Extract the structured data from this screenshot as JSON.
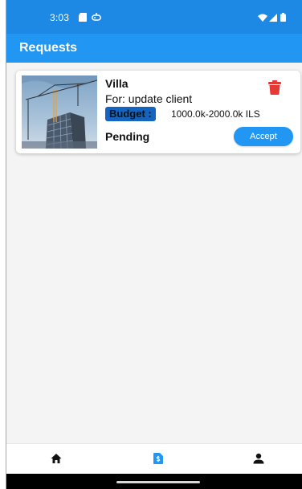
{
  "status_bar": {
    "time": "3:03",
    "icons": [
      "sd-card-icon",
      "game-controller-icon",
      "wifi-icon",
      "cell-signal-icon",
      "battery-icon"
    ]
  },
  "app_bar": {
    "title": "Requests"
  },
  "requests": [
    {
      "title": "Villa",
      "for_text": "For: update client",
      "budget_label": "Budget :",
      "budget_value": "1000.0k-2000.0k ILS",
      "status": "Pending",
      "accept_label": "Accept",
      "image": "construction-crane-building-photo"
    }
  ],
  "bottom_nav": {
    "items": [
      {
        "icon": "home-icon",
        "active": false
      },
      {
        "icon": "request-document-icon",
        "active": true
      },
      {
        "icon": "person-icon",
        "active": false
      }
    ]
  },
  "colors": {
    "primary": "#2196f3",
    "status_bar": "#1e88e5",
    "badge": "#1565c0",
    "delete": "#e53935",
    "nav_active": "#2196f3",
    "nav_inactive": "#111111"
  }
}
